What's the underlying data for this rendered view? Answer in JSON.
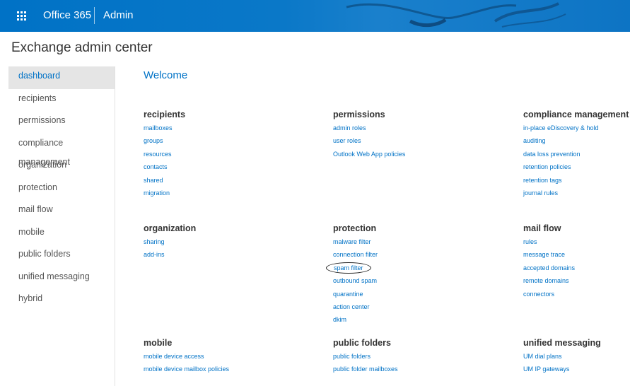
{
  "header": {
    "brand": "Office 365",
    "section": "Admin",
    "accent": "#0072c6"
  },
  "app_title": "Exchange admin center",
  "sidebar": {
    "items": [
      {
        "label": "dashboard",
        "active": true
      },
      {
        "label": "recipients"
      },
      {
        "label": "permissions"
      },
      {
        "label": "compliance management"
      },
      {
        "label": "organization"
      },
      {
        "label": "protection"
      },
      {
        "label": "mail flow"
      },
      {
        "label": "mobile"
      },
      {
        "label": "public folders"
      },
      {
        "label": "unified messaging"
      },
      {
        "label": "hybrid"
      }
    ]
  },
  "main": {
    "welcome": "Welcome",
    "sections": {
      "recipients": {
        "title": "recipients",
        "links": [
          "mailboxes",
          "groups",
          "resources",
          "contacts",
          "shared",
          "migration"
        ]
      },
      "permissions": {
        "title": "permissions",
        "links": [
          "admin roles",
          "user roles",
          "Outlook Web App policies"
        ]
      },
      "compliance": {
        "title": "compliance management",
        "links": [
          "in-place eDiscovery & hold",
          "auditing",
          "data loss prevention",
          "retention policies",
          "retention tags",
          "journal rules"
        ]
      },
      "organization": {
        "title": "organization",
        "links": [
          "sharing",
          "add-ins"
        ]
      },
      "protection": {
        "title": "protection",
        "links": [
          "malware filter",
          "connection filter",
          "spam filter",
          "outbound spam",
          "quarantine",
          "action center",
          "dkim"
        ]
      },
      "mailflow": {
        "title": "mail flow",
        "links": [
          "rules",
          "message trace",
          "accepted domains",
          "remote domains",
          "connectors"
        ]
      },
      "mobile": {
        "title": "mobile",
        "links": [
          "mobile device access",
          "mobile device mailbox policies"
        ]
      },
      "publicfolders": {
        "title": "public folders",
        "links": [
          "public folders",
          "public folder mailboxes"
        ]
      },
      "um": {
        "title": "unified messaging",
        "links": [
          "UM dial plans",
          "UM IP gateways"
        ]
      }
    }
  }
}
